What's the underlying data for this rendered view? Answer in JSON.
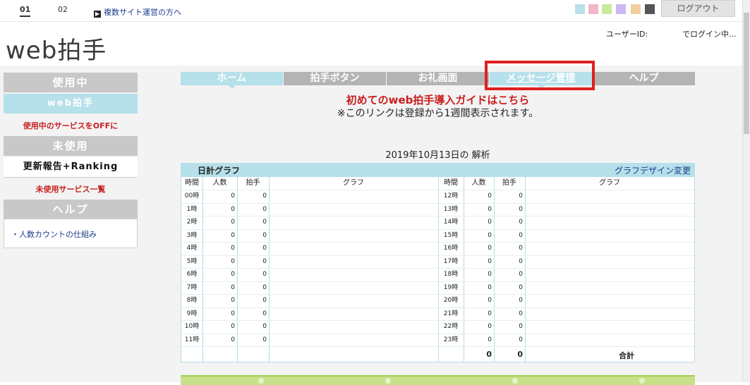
{
  "topbar": {
    "tab1": "01",
    "tab2": "02",
    "multi_site_link": "複数サイト運営の方へ",
    "logout": "ログアウト",
    "swatches": [
      "#b6e0ea",
      "#f1b7c9",
      "#c7ea9e",
      "#cdb7f0",
      "#f3cfa0",
      "#555555"
    ]
  },
  "header": {
    "title": "web拍手",
    "userid_label": "ユーザーID:",
    "userid_value": "でログイン中..."
  },
  "sidebar": {
    "in_use_head": "使用中",
    "in_use_item": "web拍手",
    "off_link": "使用中のサービスをOFFに",
    "unused_head": "未使用",
    "unused_item": "更新報告+Ranking",
    "unused_list_link": "未使用サービス一覧",
    "help_head": "ヘルプ",
    "help_item": "・人数カウントの仕組み"
  },
  "nav": {
    "home": "ホーム",
    "button": "拍手ボタン",
    "thanks": "お礼画面",
    "message": "メッセージ管理",
    "help": "ヘルプ"
  },
  "guide": {
    "link": "初めてのweb拍手導入ガイドはこちら",
    "note": "※このリンクは登録から1週間表示されます。"
  },
  "analysis": {
    "date_title": "2019年10月13日の 解析",
    "graph_title": "日計グラフ",
    "graph_design": "グラフデザイン変更",
    "headers": {
      "time": "時間",
      "people": "人数",
      "clap": "拍手",
      "graph": "グラフ"
    },
    "left_rows": [
      {
        "time": "00時",
        "people": "0",
        "clap": "0"
      },
      {
        "time": "1時",
        "people": "0",
        "clap": "0"
      },
      {
        "time": "2時",
        "people": "0",
        "clap": "0"
      },
      {
        "time": "3時",
        "people": "0",
        "clap": "0"
      },
      {
        "time": "4時",
        "people": "0",
        "clap": "0"
      },
      {
        "time": "5時",
        "people": "0",
        "clap": "0"
      },
      {
        "time": "6時",
        "people": "0",
        "clap": "0"
      },
      {
        "time": "7時",
        "people": "0",
        "clap": "0"
      },
      {
        "time": "8時",
        "people": "0",
        "clap": "0"
      },
      {
        "time": "9時",
        "people": "0",
        "clap": "0"
      },
      {
        "time": "10時",
        "people": "0",
        "clap": "0"
      },
      {
        "time": "11時",
        "people": "0",
        "clap": "0"
      }
    ],
    "right_rows": [
      {
        "time": "12時",
        "people": "0",
        "clap": "0"
      },
      {
        "time": "13時",
        "people": "0",
        "clap": "0"
      },
      {
        "time": "14時",
        "people": "0",
        "clap": "0"
      },
      {
        "time": "15時",
        "people": "0",
        "clap": "0"
      },
      {
        "time": "16時",
        "people": "0",
        "clap": "0"
      },
      {
        "time": "17時",
        "people": "0",
        "clap": "0"
      },
      {
        "time": "18時",
        "people": "0",
        "clap": "0"
      },
      {
        "time": "19時",
        "people": "0",
        "clap": "0"
      },
      {
        "time": "20時",
        "people": "0",
        "clap": "0"
      },
      {
        "time": "21時",
        "people": "0",
        "clap": "0"
      },
      {
        "time": "22時",
        "people": "0",
        "clap": "0"
      },
      {
        "time": "23時",
        "people": "0",
        "clap": "0"
      }
    ],
    "total_label": "合計",
    "total_people": "0",
    "total_clap": "0"
  }
}
